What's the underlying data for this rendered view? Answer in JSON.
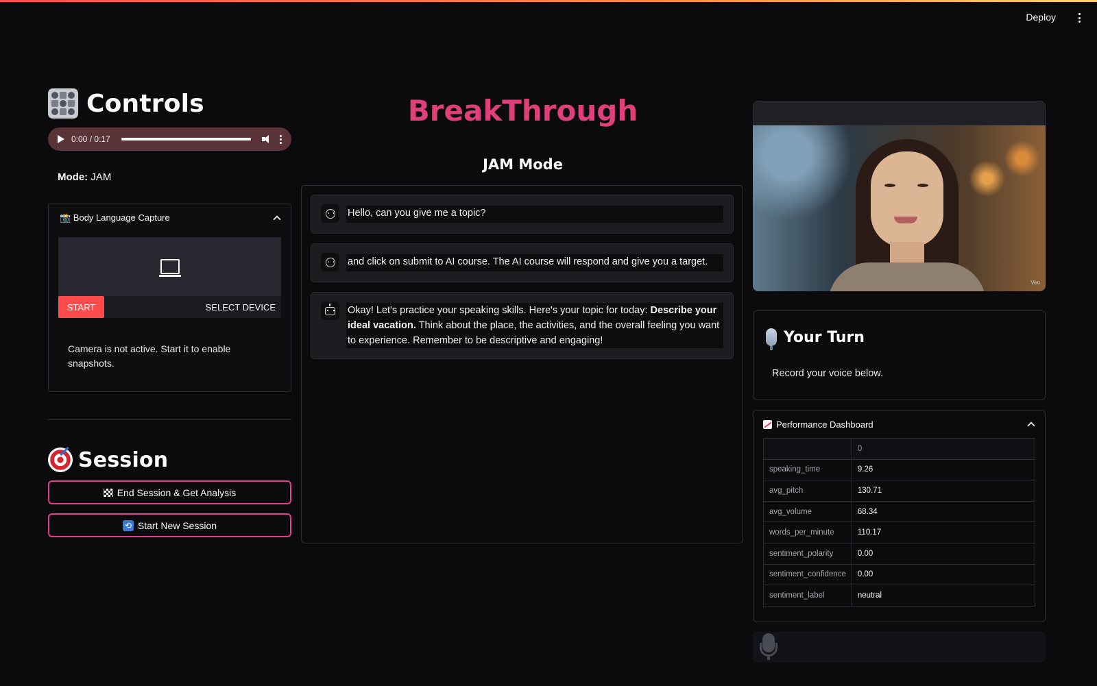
{
  "topbar": {
    "deploy_label": "Deploy"
  },
  "controls": {
    "title": "Controls",
    "audio": {
      "time": "0:00 / 0:17",
      "progress": 1.0
    },
    "mode_label": "Mode:",
    "mode_value": "JAM",
    "body_language": {
      "header": "📸 Body Language Capture",
      "start_label": "START",
      "select_device_label": "SELECT DEVICE",
      "note": "Camera is not active. Start it to enable snapshots."
    }
  },
  "session": {
    "title": "Session",
    "end_button": "End Session & Get Analysis",
    "new_button": "Start New Session"
  },
  "brand": "BreakThrough",
  "jam_title": "JAM Mode",
  "chat": {
    "messages": [
      {
        "role": "user",
        "text": "Hello, can you give me a topic?"
      },
      {
        "role": "user",
        "text": "and click on submit to AI course. The AI course will respond and give you a target."
      },
      {
        "role": "assistant",
        "text_a": "Okay! Let's practice your speaking skills. Here's your topic for today: ",
        "text_bold": "Describe your ideal vacation.",
        "text_b": " Think about the place, the activities, and the overall feeling you want to experience. Remember to be descriptive and engaging!"
      }
    ]
  },
  "video": {
    "watermark": "Veo"
  },
  "your_turn": {
    "title": "Your Turn",
    "subtitle": "Record your voice below."
  },
  "performance": {
    "header": "Performance Dashboard",
    "column_header": "0",
    "rows": [
      {
        "key": "speaking_time",
        "value": "9.26"
      },
      {
        "key": "avg_pitch",
        "value": "130.71"
      },
      {
        "key": "avg_volume",
        "value": "68.34"
      },
      {
        "key": "words_per_minute",
        "value": "110.17"
      },
      {
        "key": "sentiment_polarity",
        "value": "0.00"
      },
      {
        "key": "sentiment_confidence",
        "value": "0.00"
      },
      {
        "key": "sentiment_label",
        "value": "neutral"
      }
    ]
  },
  "colors": {
    "brand": "#e0407a",
    "start": "#ff4b4b",
    "outline": "#e0408f"
  }
}
